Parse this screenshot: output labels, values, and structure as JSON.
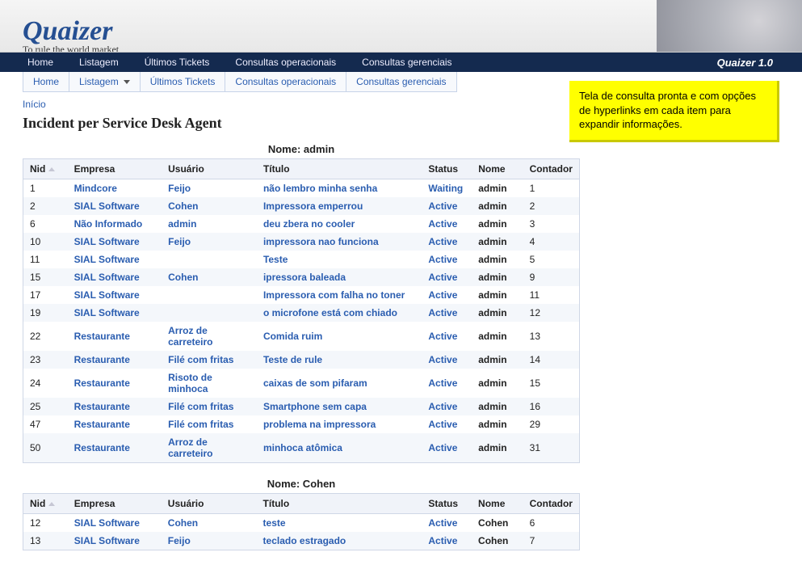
{
  "brand": {
    "name": "Quaizer",
    "tagline": "To rule the world market",
    "version": "Quaizer 1.0"
  },
  "topnav": [
    "Home",
    "Listagem",
    "Últimos Tickets",
    "Consultas operacionais",
    "Consultas gerenciais"
  ],
  "subnav": [
    {
      "label": "Home",
      "dropdown": false
    },
    {
      "label": "Listagem",
      "dropdown": true
    },
    {
      "label": "Últimos Tickets",
      "dropdown": false
    },
    {
      "label": "Consultas operacionais",
      "dropdown": false
    },
    {
      "label": "Consultas gerenciais",
      "dropdown": false
    }
  ],
  "breadcrumb": "Início",
  "page_title": "Incident per Service Desk Agent",
  "callout": "Tela de consulta pronta e com opções de hyperlinks em cada item para expandir informações.",
  "columns": {
    "nid": "Nid",
    "empresa": "Empresa",
    "usuario": "Usuário",
    "titulo": "Título",
    "status": "Status",
    "nome": "Nome",
    "contador": "Contador"
  },
  "group_label_prefix": "Nome:",
  "groups": [
    {
      "name": "admin",
      "rows": [
        {
          "nid": "1",
          "empresa": "Mindcore",
          "usuario": "Feijo",
          "titulo": "não lembro minha senha",
          "status": "Waiting",
          "nome": "admin",
          "contador": "1"
        },
        {
          "nid": "2",
          "empresa": "SIAL Software",
          "usuario": "Cohen",
          "titulo": "Impressora emperrou",
          "status": "Active",
          "nome": "admin",
          "contador": "2"
        },
        {
          "nid": "6",
          "empresa": "Não Informado",
          "usuario": "admin",
          "titulo": "deu zbera no cooler",
          "status": "Active",
          "nome": "admin",
          "contador": "3"
        },
        {
          "nid": "10",
          "empresa": "SIAL Software",
          "usuario": "Feijo",
          "titulo": "impressora nao funciona",
          "status": "Active",
          "nome": "admin",
          "contador": "4"
        },
        {
          "nid": "11",
          "empresa": "SIAL Software",
          "usuario": "",
          "titulo": "Teste",
          "status": "Active",
          "nome": "admin",
          "contador": "5"
        },
        {
          "nid": "15",
          "empresa": "SIAL Software",
          "usuario": "Cohen",
          "titulo": "ipressora baleada",
          "status": "Active",
          "nome": "admin",
          "contador": "9"
        },
        {
          "nid": "17",
          "empresa": "SIAL Software",
          "usuario": "",
          "titulo": "Impressora com falha no toner",
          "status": "Active",
          "nome": "admin",
          "contador": "11"
        },
        {
          "nid": "19",
          "empresa": "SIAL Software",
          "usuario": "",
          "titulo": "o microfone está com chiado",
          "status": "Active",
          "nome": "admin",
          "contador": "12"
        },
        {
          "nid": "22",
          "empresa": "Restaurante",
          "usuario": "Arroz de carreteiro",
          "titulo": "Comida ruim",
          "status": "Active",
          "nome": "admin",
          "contador": "13"
        },
        {
          "nid": "23",
          "empresa": "Restaurante",
          "usuario": "Filé com fritas",
          "titulo": "Teste de rule",
          "status": "Active",
          "nome": "admin",
          "contador": "14"
        },
        {
          "nid": "24",
          "empresa": "Restaurante",
          "usuario": "Risoto de minhoca",
          "titulo": "caixas de som pifaram",
          "status": "Active",
          "nome": "admin",
          "contador": "15"
        },
        {
          "nid": "25",
          "empresa": "Restaurante",
          "usuario": "Filé com fritas",
          "titulo": "Smartphone sem capa",
          "status": "Active",
          "nome": "admin",
          "contador": "16"
        },
        {
          "nid": "47",
          "empresa": "Restaurante",
          "usuario": "Filé com fritas",
          "titulo": "problema na impressora",
          "status": "Active",
          "nome": "admin",
          "contador": "29"
        },
        {
          "nid": "50",
          "empresa": "Restaurante",
          "usuario": "Arroz de carreteiro",
          "titulo": "minhoca atômica",
          "status": "Active",
          "nome": "admin",
          "contador": "31"
        }
      ]
    },
    {
      "name": "Cohen",
      "rows": [
        {
          "nid": "12",
          "empresa": "SIAL Software",
          "usuario": "Cohen",
          "titulo": "teste",
          "status": "Active",
          "nome": "Cohen",
          "contador": "6"
        },
        {
          "nid": "13",
          "empresa": "SIAL Software",
          "usuario": "Feijo",
          "titulo": "teclado estragado",
          "status": "Active",
          "nome": "Cohen",
          "contador": "7"
        }
      ]
    }
  ]
}
